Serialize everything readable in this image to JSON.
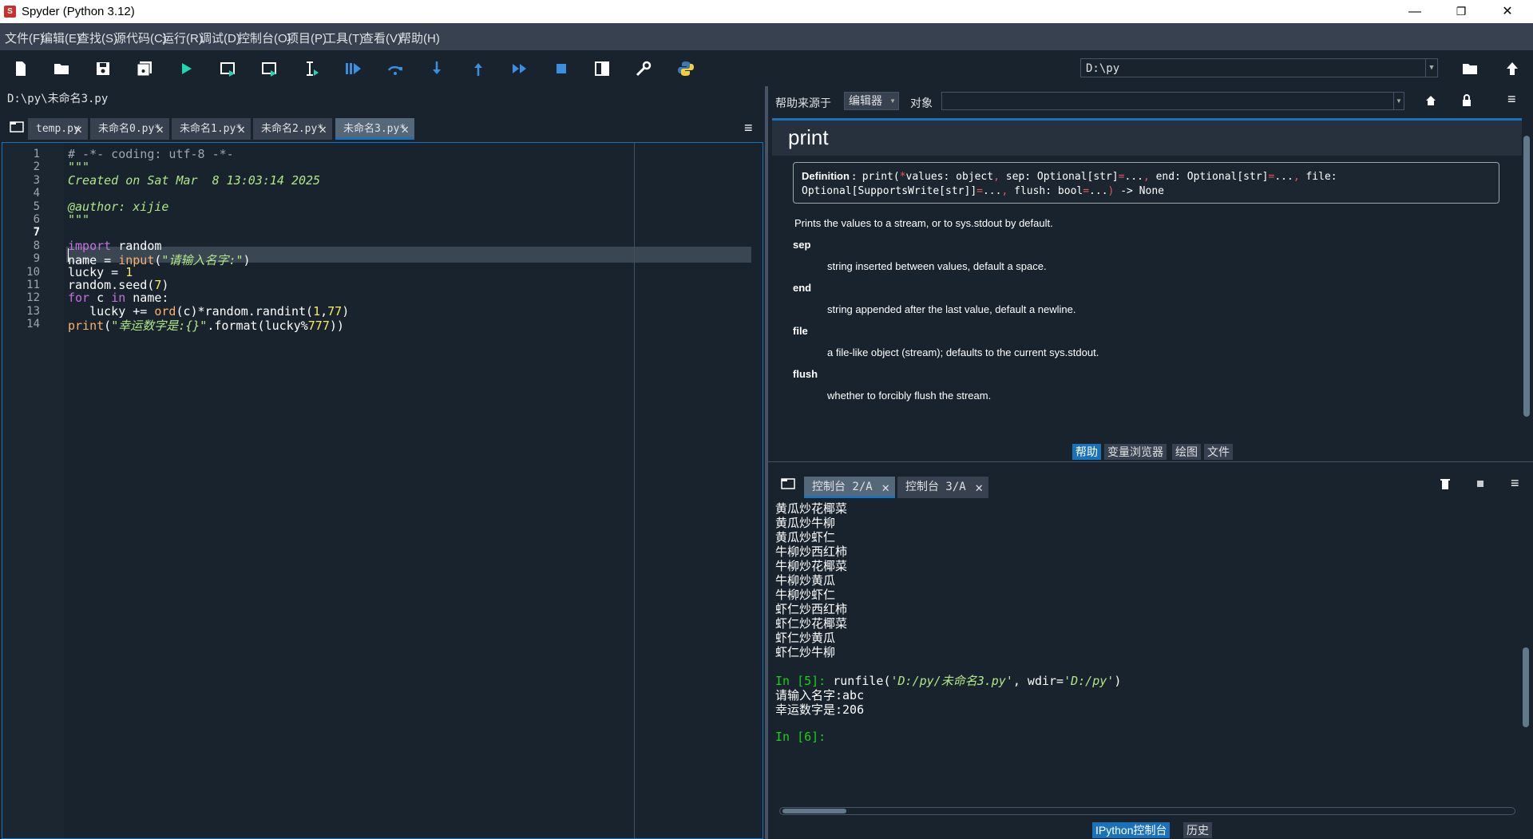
{
  "window": {
    "title": "Spyder (Python 3.12)",
    "logo_text": "S",
    "minimize": "—",
    "restore": "❐",
    "close": "✕"
  },
  "menu": [
    "文件(F)",
    "编辑(E)",
    "查找(S)",
    "源代码(C)",
    "运行(R)",
    "调试(D)",
    "控制台(O)",
    "项目(P)",
    "工具(T)",
    "查看(V)",
    "帮助(H)"
  ],
  "toolbar": {
    "icons": [
      "new-file-icon",
      "open-file-icon",
      "save-icon",
      "save-all-icon",
      "run-icon",
      "run-cell-icon",
      "run-cell-advance-icon",
      "run-selection-icon",
      "debug-icon",
      "step-over-icon",
      "step-into-icon",
      "step-return-icon",
      "continue-icon",
      "stop-icon",
      "maximize-pane-icon",
      "preferences-icon",
      "python-path-icon"
    ],
    "working_dir": "D:\\py",
    "browse_icon": "folder-icon",
    "parent_dir_icon": "up-arrow-icon"
  },
  "editor": {
    "file_path": "D:\\py\\未命名3.py",
    "tabs": [
      {
        "label": "temp.py",
        "active": false
      },
      {
        "label": "未命名0.py*",
        "active": false
      },
      {
        "label": "未命名1.py*",
        "active": false
      },
      {
        "label": "未命名2.py*",
        "active": false
      },
      {
        "label": "未命名3.py*",
        "active": true
      }
    ],
    "current_line": 7,
    "lines": [
      [
        {
          "t": "# -*- coding: utf-8 -*-",
          "c": "comment"
        }
      ],
      [
        {
          "t": "\"\"\"",
          "c": "string"
        }
      ],
      [
        {
          "t": "Created on Sat Mar  8 13:03:14 2025",
          "c": "string"
        }
      ],
      [
        {
          "t": "",
          "c": "plain"
        }
      ],
      [
        {
          "t": "@author: xijie",
          "c": "string"
        }
      ],
      [
        {
          "t": "\"\"\"",
          "c": "string"
        }
      ],
      [
        {
          "t": "",
          "c": "plain"
        }
      ],
      [
        {
          "t": "import",
          "c": "keyword"
        },
        {
          "t": " random",
          "c": "plain"
        }
      ],
      [
        {
          "t": "name = ",
          "c": "plain"
        },
        {
          "t": "input",
          "c": "builtin"
        },
        {
          "t": "(",
          "c": "plain"
        },
        {
          "t": "\"请输入名字:\"",
          "c": "string"
        },
        {
          "t": ")",
          "c": "plain"
        }
      ],
      [
        {
          "t": "lucky = ",
          "c": "plain"
        },
        {
          "t": "1",
          "c": "number"
        }
      ],
      [
        {
          "t": "random.seed(",
          "c": "plain"
        },
        {
          "t": "7",
          "c": "number"
        },
        {
          "t": ")",
          "c": "plain"
        }
      ],
      [
        {
          "t": "for",
          "c": "keyword"
        },
        {
          "t": " c ",
          "c": "plain"
        },
        {
          "t": "in",
          "c": "keyword"
        },
        {
          "t": " name:",
          "c": "plain"
        }
      ],
      [
        {
          "t": "   lucky += ",
          "c": "plain"
        },
        {
          "t": "ord",
          "c": "builtin"
        },
        {
          "t": "(c)*random.randint(",
          "c": "plain"
        },
        {
          "t": "1",
          "c": "number"
        },
        {
          "t": ",",
          "c": "plain"
        },
        {
          "t": "77",
          "c": "number"
        },
        {
          "t": ")",
          "c": "plain"
        }
      ],
      [
        {
          "t": "print",
          "c": "builtin"
        },
        {
          "t": "(",
          "c": "plain"
        },
        {
          "t": "\"幸运数字是:{}\"",
          "c": "string"
        },
        {
          "t": ".format(lucky%",
          "c": "plain"
        },
        {
          "t": "777",
          "c": "number"
        },
        {
          "t": "))",
          "c": "plain"
        }
      ]
    ]
  },
  "help": {
    "source_label": "帮助来源于",
    "source_value": "编辑器",
    "object_label": "对象",
    "object_value": "",
    "title": "print",
    "def_label": "Definition :",
    "def_line1": [
      {
        "t": " print(",
        "c": "plain"
      },
      {
        "t": "*",
        "c": "op"
      },
      {
        "t": "values: object",
        "c": "plain"
      },
      {
        "t": ", ",
        "c": "op"
      },
      {
        "t": "sep: Optional[str]",
        "c": "plain"
      },
      {
        "t": "=",
        "c": "op"
      },
      {
        "t": "...",
        "c": "plain"
      },
      {
        "t": ", ",
        "c": "op"
      },
      {
        "t": "end: Optional[str]",
        "c": "plain"
      },
      {
        "t": "=",
        "c": "op"
      },
      {
        "t": "...",
        "c": "plain"
      },
      {
        "t": ", ",
        "c": "op"
      },
      {
        "t": "file:",
        "c": "plain"
      }
    ],
    "def_line2": [
      {
        "t": "Optional[SupportsWrite[str]]",
        "c": "plain"
      },
      {
        "t": "=",
        "c": "op"
      },
      {
        "t": "...",
        "c": "plain"
      },
      {
        "t": ", ",
        "c": "op"
      },
      {
        "t": "flush: bool",
        "c": "plain"
      },
      {
        "t": "=",
        "c": "op"
      },
      {
        "t": "...",
        "c": "plain"
      },
      {
        "t": ") ",
        "c": "op"
      },
      {
        "t": "-> None",
        "c": "plain"
      }
    ],
    "summary": "Prints the values to a stream, or to sys.stdout by default.",
    "params": [
      {
        "name": "sep",
        "desc": "string inserted between values, default a space."
      },
      {
        "name": "end",
        "desc": "string appended after the last value, default a newline."
      },
      {
        "name": "file",
        "desc": "a file-like object (stream); defaults to the current sys.stdout."
      },
      {
        "name": "flush",
        "desc": "whether to forcibly flush the stream."
      }
    ],
    "bottom_tabs": [
      {
        "label": "帮助",
        "active": true
      },
      {
        "label": "变量浏览器",
        "active": false
      },
      {
        "label": "绘图",
        "active": false
      },
      {
        "label": "文件",
        "active": false
      }
    ]
  },
  "console": {
    "tabs": [
      {
        "label": "控制台 2/A",
        "active": true
      },
      {
        "label": "控制台 3/A",
        "active": false
      }
    ],
    "output_lines": [
      "黄瓜炒花椰菜",
      "黄瓜炒牛柳",
      "黄瓜炒虾仁",
      "牛柳炒西红柿",
      "牛柳炒花椰菜",
      "牛柳炒黄瓜",
      "牛柳炒虾仁",
      "虾仁炒西红柿",
      "虾仁炒花椰菜",
      "虾仁炒黄瓜",
      "虾仁炒牛柳"
    ],
    "in5_prompt": "In [5]:",
    "in5_cmd": [
      {
        "t": " runfile(",
        "c": "plain"
      },
      {
        "t": "'D:/py/未命名3.py'",
        "c": "string"
      },
      {
        "t": ", wdir=",
        "c": "plain"
      },
      {
        "t": "'D:/py'",
        "c": "string"
      },
      {
        "t": ")",
        "c": "plain"
      }
    ],
    "result_lines": [
      "请输入名字:abc",
      "幸运数字是:206"
    ],
    "in6_prompt": "In [6]:",
    "bottom_tabs": [
      {
        "label": "IPython控制台",
        "active": true
      },
      {
        "label": "历史",
        "active": false
      }
    ]
  },
  "colors": {
    "comment": "#9ea6ad",
    "string": "#b0e686",
    "keyword": "#c670e0",
    "builtin": "#fab16c",
    "number": "#faed5c",
    "plain": "#ffffff",
    "op": "#e8555a",
    "prompt": "#17d217",
    "accent": "#1a72bb"
  }
}
